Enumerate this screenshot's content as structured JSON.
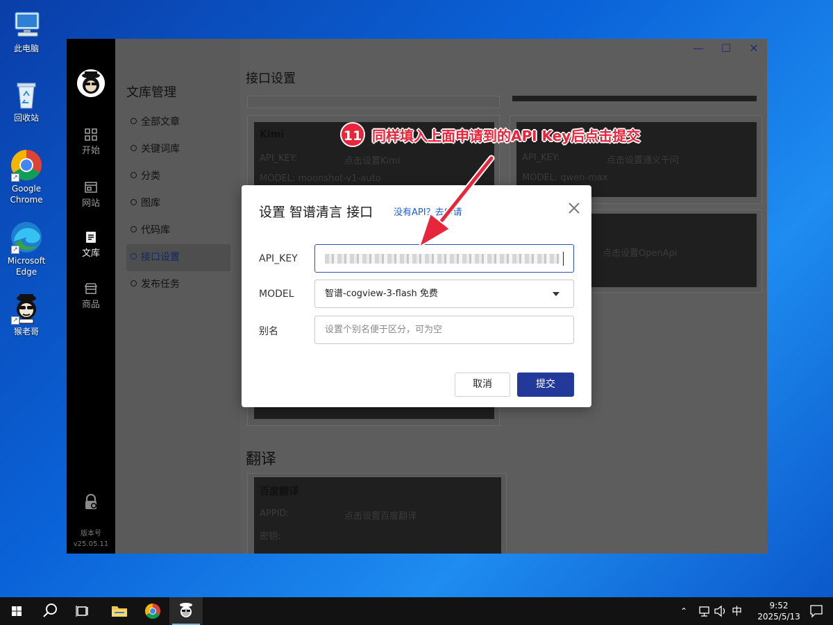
{
  "desktop": {
    "icons": [
      {
        "label": "此电脑",
        "icon": "computer-icon"
      },
      {
        "label": "回收站",
        "icon": "recycle-bin-icon"
      },
      {
        "label": "Google Chrome",
        "icon": "chrome-icon"
      },
      {
        "label": "Microsoft Edge",
        "icon": "edge-icon"
      },
      {
        "label": "猴老哥",
        "icon": "monkey-app-icon"
      }
    ]
  },
  "app": {
    "rail": {
      "items": [
        {
          "label": "开始",
          "icon": "grid-icon"
        },
        {
          "label": "网站",
          "icon": "website-icon"
        },
        {
          "label": "文库",
          "icon": "document-icon"
        },
        {
          "label": "商品",
          "icon": "store-icon"
        }
      ],
      "version_label": "版本号",
      "version_value": "v25.05.11"
    },
    "sidebar": {
      "title": "文库管理",
      "items": [
        "全部文章",
        "关键词库",
        "分类",
        "图库",
        "代码库",
        "接口设置",
        "发布任务"
      ],
      "active_index": 5
    },
    "main": {
      "section_title": "接口设置",
      "cards": {
        "kimi": {
          "title": "Kimi",
          "api_key_label": "API_KEY:",
          "api_key_value": "点击设置Kimi",
          "model_label": "MODEL: moonshot-v1-auto"
        },
        "qwen": {
          "api_key_label": "API_KEY:",
          "api_key_value": "点击设置通义千问",
          "model_label": "MODEL: qwen-max"
        },
        "openapi": {
          "api_key_value": "点击设置OpenApi"
        }
      },
      "translate_title": "翻译",
      "baidu": {
        "title": "百度翻译",
        "appid_label": "APPID:",
        "appid_value": "点击设置百度翻译",
        "secret_label": "密钥:"
      }
    }
  },
  "dialog": {
    "title": "设置 智谱清言 接口",
    "apply_link": "没有API？去申请",
    "api_key_label": "API_KEY",
    "model_label": "MODEL",
    "model_value": "智谱-cogview-3-flash 免费",
    "alias_label": "别名",
    "alias_placeholder": "设置个别名便于区分，可为空",
    "cancel": "取消",
    "submit": "提交"
  },
  "annotation": {
    "step": "11",
    "text": "同样填入上面申请到的API Key后点击提交",
    "color": "#e8263b"
  },
  "taskbar": {
    "time": "9:52",
    "date": "2025/5/13",
    "ime": "中"
  }
}
